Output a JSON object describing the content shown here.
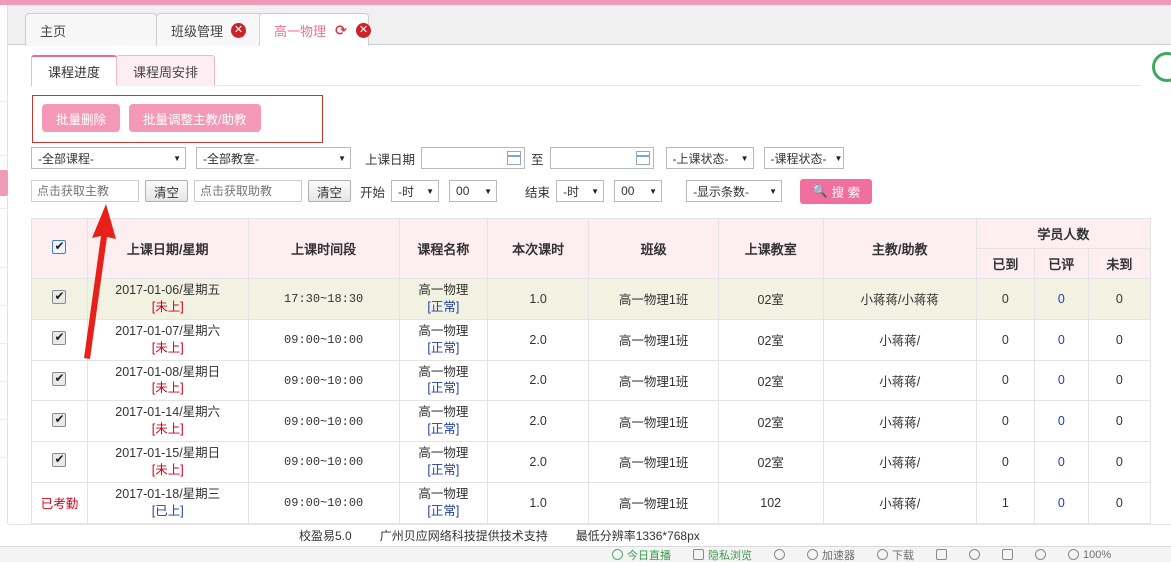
{
  "browser_tabs": [
    {
      "label": "主页",
      "closable": false,
      "reload": false,
      "active": false
    },
    {
      "label": "班级管理",
      "closable": true,
      "reload": false,
      "active": false
    },
    {
      "label": "高一物理",
      "closable": true,
      "reload": true,
      "active": true
    }
  ],
  "module_tabs": [
    {
      "label": "课程进度",
      "active": true
    },
    {
      "label": "课程周安排",
      "active": false
    }
  ],
  "batch_actions": {
    "delete_label": "批量删除",
    "adjust_label": "批量调整主教/助教",
    "highlight_color": "#c0392b",
    "button_color": "#f498b8"
  },
  "filters": {
    "course_select": "-全部课程-",
    "room_select": "-全部教室-",
    "date_label": "上课日期",
    "date_from": "",
    "date_to": "",
    "date_separator": "至",
    "class_status_select": "-上课状态-",
    "course_status_select": "-课程状态-",
    "main_teacher_placeholder": "点击获取主教",
    "main_teacher_value": "",
    "clear_label_1": "清空",
    "assist_teacher_placeholder": "点击获取助教",
    "assist_teacher_value": "",
    "clear_label_2": "清空",
    "start_label": "开始",
    "start_hour": "-时",
    "start_minute": "00",
    "end_label": "结束",
    "end_hour": "-时",
    "end_minute": "00",
    "page_size_select": "-显示条数-",
    "search_label": "搜 索",
    "search_icon": "search-icon"
  },
  "table": {
    "headers": {
      "select_all": "select-all-checkbox",
      "date_week": "上课日期/星期",
      "time_range": "上课时间段",
      "course_name": "课程名称",
      "lesson_hours": "本次课时",
      "class_group": "班级",
      "classroom": "上课教室",
      "teachers": "主教/助教",
      "student_count": "学员人数",
      "arrived": "已到",
      "rated": "已评",
      "absent": "未到"
    },
    "rows": [
      {
        "select": "checkbox",
        "attendance_label": "",
        "date": "2017-01-06/星期五",
        "status": "[未上]",
        "status_kind": "red",
        "time": "17:30~18:30",
        "course": "高一物理",
        "course_status": "[正常]",
        "course_status_kind": "blue",
        "hours": "1.0",
        "class_group": "高一物理1班",
        "classroom": "02室",
        "teachers": "小蒋蒋/小蒋蒋",
        "arrived": "0",
        "rated": "0",
        "absent": "0",
        "highlight": true
      },
      {
        "select": "checkbox",
        "attendance_label": "",
        "date": "2017-01-07/星期六",
        "status": "[未上]",
        "status_kind": "red",
        "time": "09:00~10:00",
        "course": "高一物理",
        "course_status": "[正常]",
        "course_status_kind": "blue",
        "hours": "2.0",
        "class_group": "高一物理1班",
        "classroom": "02室",
        "teachers": "小蒋蒋/",
        "arrived": "0",
        "rated": "0",
        "absent": "0",
        "highlight": false
      },
      {
        "select": "checkbox",
        "attendance_label": "",
        "date": "2017-01-08/星期日",
        "status": "[未上]",
        "status_kind": "red",
        "time": "09:00~10:00",
        "course": "高一物理",
        "course_status": "[正常]",
        "course_status_kind": "blue",
        "hours": "2.0",
        "class_group": "高一物理1班",
        "classroom": "02室",
        "teachers": "小蒋蒋/",
        "arrived": "0",
        "rated": "0",
        "absent": "0",
        "highlight": false
      },
      {
        "select": "checkbox",
        "attendance_label": "",
        "date": "2017-01-14/星期六",
        "status": "[未上]",
        "status_kind": "red",
        "time": "09:00~10:00",
        "course": "高一物理",
        "course_status": "[正常]",
        "course_status_kind": "blue",
        "hours": "2.0",
        "class_group": "高一物理1班",
        "classroom": "02室",
        "teachers": "小蒋蒋/",
        "arrived": "0",
        "rated": "0",
        "absent": "0",
        "highlight": false
      },
      {
        "select": "checkbox",
        "attendance_label": "",
        "date": "2017-01-15/星期日",
        "status": "[未上]",
        "status_kind": "red",
        "time": "09:00~10:00",
        "course": "高一物理",
        "course_status": "[正常]",
        "course_status_kind": "blue",
        "hours": "2.0",
        "class_group": "高一物理1班",
        "classroom": "02室",
        "teachers": "小蒋蒋/",
        "arrived": "0",
        "rated": "0",
        "absent": "0",
        "highlight": false
      },
      {
        "select": "text",
        "attendance_label": "已考勤",
        "date": "2017-01-18/星期三",
        "status": "[已上]",
        "status_kind": "blue",
        "time": "09:00~10:00",
        "course": "高一物理",
        "course_status": "[正常]",
        "course_status_kind": "blue",
        "hours": "1.0",
        "class_group": "高一物理1班",
        "classroom": "102",
        "teachers": "小蒋蒋/",
        "arrived": "1",
        "rated": "0",
        "absent": "0",
        "highlight": false
      }
    ]
  },
  "footer": {
    "product": "校盈易5.0",
    "support": "广州贝应网络科技提供技术支持",
    "resolution": "最低分辨率1336*768px"
  },
  "browser_bar": {
    "items": [
      {
        "label": "今日直播",
        "icon": "play-circle-icon",
        "green": true
      },
      {
        "label": "隐私浏览",
        "icon": "window-icon",
        "green": true
      },
      {
        "label": "",
        "icon": "mute-icon",
        "green": false
      },
      {
        "label": "加速器",
        "icon": "rocket-icon",
        "green": false
      },
      {
        "label": "下载",
        "icon": "download-icon",
        "green": false
      },
      {
        "label": "",
        "icon": "screen-icon",
        "green": false
      },
      {
        "label": "",
        "icon": "shield-icon",
        "green": false
      },
      {
        "label": "",
        "icon": "book-icon",
        "green": false
      },
      {
        "label": "",
        "icon": "volume-icon",
        "green": false
      },
      {
        "label": "100%",
        "icon": "zoom-icon",
        "green": false
      }
    ]
  }
}
